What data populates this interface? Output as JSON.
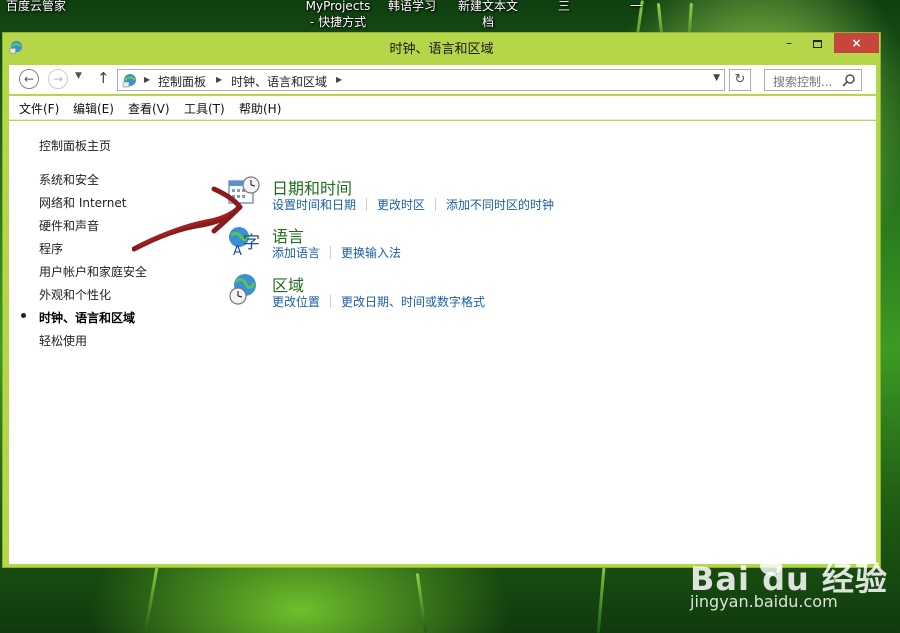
{
  "desktop": {
    "icons": [
      {
        "label": "百度云管家"
      },
      {
        "label": "MyProjects\n- 快捷方式"
      },
      {
        "label": "韩语学习"
      },
      {
        "label": "新建文本文\n档"
      },
      {
        "label": "三"
      },
      {
        "label": "一"
      }
    ]
  },
  "window": {
    "title": "时钟、语言和区域",
    "controls": {
      "minimize": "–",
      "close": "×"
    }
  },
  "address": {
    "crumbs": [
      "控制面板",
      "时钟、语言和区域"
    ],
    "search_placeholder": "搜索控制..."
  },
  "menu": [
    "文件(F)",
    "编辑(E)",
    "查看(V)",
    "工具(T)",
    "帮助(H)"
  ],
  "sidebar": {
    "home": "控制面板主页",
    "items": [
      "系统和安全",
      "网络和 Internet",
      "硬件和声音",
      "程序",
      "用户帐户和家庭安全",
      "外观和个性化",
      "时钟、语言和区域",
      "轻松使用"
    ],
    "active_index": 6
  },
  "categories": [
    {
      "title": "日期和时间",
      "icon": "calendar-clock-icon",
      "links": [
        "设置时间和日期",
        "更改时区",
        "添加不同时区的时钟"
      ]
    },
    {
      "title": "语言",
      "icon": "language-icon",
      "links": [
        "添加语言",
        "更换输入法"
      ]
    },
    {
      "title": "区域",
      "icon": "globe-clock-icon",
      "links": [
        "更改位置",
        "更改日期、时间或数字格式"
      ]
    }
  ],
  "watermark": {
    "logo": "Bai du 经验",
    "url": "jingyan.baidu.com"
  },
  "colors": {
    "window_frame": "#b5d649",
    "close_button": "#c7463b",
    "category_title": "#1d6e1d",
    "link": "#1a5fa6",
    "annotation_arrow": "#8b1a1a"
  }
}
